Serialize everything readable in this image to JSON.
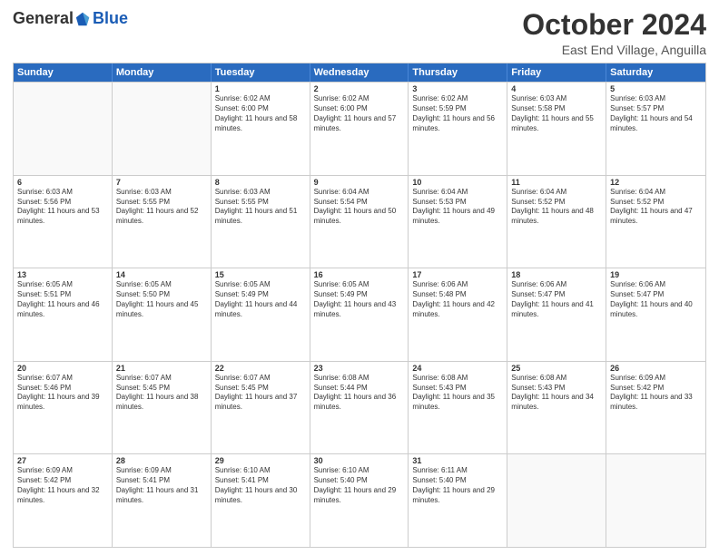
{
  "header": {
    "logo": {
      "general": "General",
      "blue": "Blue"
    },
    "month": "October 2024",
    "location": "East End Village, Anguilla"
  },
  "calendar": {
    "days_of_week": [
      "Sunday",
      "Monday",
      "Tuesday",
      "Wednesday",
      "Thursday",
      "Friday",
      "Saturday"
    ],
    "weeks": [
      [
        {
          "day": "",
          "empty": true
        },
        {
          "day": "",
          "empty": true
        },
        {
          "day": "1",
          "sunrise": "6:02 AM",
          "sunset": "6:00 PM",
          "daylight": "11 hours and 58 minutes."
        },
        {
          "day": "2",
          "sunrise": "6:02 AM",
          "sunset": "6:00 PM",
          "daylight": "11 hours and 57 minutes."
        },
        {
          "day": "3",
          "sunrise": "6:02 AM",
          "sunset": "5:59 PM",
          "daylight": "11 hours and 56 minutes."
        },
        {
          "day": "4",
          "sunrise": "6:03 AM",
          "sunset": "5:58 PM",
          "daylight": "11 hours and 55 minutes."
        },
        {
          "day": "5",
          "sunrise": "6:03 AM",
          "sunset": "5:57 PM",
          "daylight": "11 hours and 54 minutes."
        }
      ],
      [
        {
          "day": "6",
          "sunrise": "6:03 AM",
          "sunset": "5:56 PM",
          "daylight": "11 hours and 53 minutes."
        },
        {
          "day": "7",
          "sunrise": "6:03 AM",
          "sunset": "5:55 PM",
          "daylight": "11 hours and 52 minutes."
        },
        {
          "day": "8",
          "sunrise": "6:03 AM",
          "sunset": "5:55 PM",
          "daylight": "11 hours and 51 minutes."
        },
        {
          "day": "9",
          "sunrise": "6:04 AM",
          "sunset": "5:54 PM",
          "daylight": "11 hours and 50 minutes."
        },
        {
          "day": "10",
          "sunrise": "6:04 AM",
          "sunset": "5:53 PM",
          "daylight": "11 hours and 49 minutes."
        },
        {
          "day": "11",
          "sunrise": "6:04 AM",
          "sunset": "5:52 PM",
          "daylight": "11 hours and 48 minutes."
        },
        {
          "day": "12",
          "sunrise": "6:04 AM",
          "sunset": "5:52 PM",
          "daylight": "11 hours and 47 minutes."
        }
      ],
      [
        {
          "day": "13",
          "sunrise": "6:05 AM",
          "sunset": "5:51 PM",
          "daylight": "11 hours and 46 minutes."
        },
        {
          "day": "14",
          "sunrise": "6:05 AM",
          "sunset": "5:50 PM",
          "daylight": "11 hours and 45 minutes."
        },
        {
          "day": "15",
          "sunrise": "6:05 AM",
          "sunset": "5:49 PM",
          "daylight": "11 hours and 44 minutes."
        },
        {
          "day": "16",
          "sunrise": "6:05 AM",
          "sunset": "5:49 PM",
          "daylight": "11 hours and 43 minutes."
        },
        {
          "day": "17",
          "sunrise": "6:06 AM",
          "sunset": "5:48 PM",
          "daylight": "11 hours and 42 minutes."
        },
        {
          "day": "18",
          "sunrise": "6:06 AM",
          "sunset": "5:47 PM",
          "daylight": "11 hours and 41 minutes."
        },
        {
          "day": "19",
          "sunrise": "6:06 AM",
          "sunset": "5:47 PM",
          "daylight": "11 hours and 40 minutes."
        }
      ],
      [
        {
          "day": "20",
          "sunrise": "6:07 AM",
          "sunset": "5:46 PM",
          "daylight": "11 hours and 39 minutes."
        },
        {
          "day": "21",
          "sunrise": "6:07 AM",
          "sunset": "5:45 PM",
          "daylight": "11 hours and 38 minutes."
        },
        {
          "day": "22",
          "sunrise": "6:07 AM",
          "sunset": "5:45 PM",
          "daylight": "11 hours and 37 minutes."
        },
        {
          "day": "23",
          "sunrise": "6:08 AM",
          "sunset": "5:44 PM",
          "daylight": "11 hours and 36 minutes."
        },
        {
          "day": "24",
          "sunrise": "6:08 AM",
          "sunset": "5:43 PM",
          "daylight": "11 hours and 35 minutes."
        },
        {
          "day": "25",
          "sunrise": "6:08 AM",
          "sunset": "5:43 PM",
          "daylight": "11 hours and 34 minutes."
        },
        {
          "day": "26",
          "sunrise": "6:09 AM",
          "sunset": "5:42 PM",
          "daylight": "11 hours and 33 minutes."
        }
      ],
      [
        {
          "day": "27",
          "sunrise": "6:09 AM",
          "sunset": "5:42 PM",
          "daylight": "11 hours and 32 minutes."
        },
        {
          "day": "28",
          "sunrise": "6:09 AM",
          "sunset": "5:41 PM",
          "daylight": "11 hours and 31 minutes."
        },
        {
          "day": "29",
          "sunrise": "6:10 AM",
          "sunset": "5:41 PM",
          "daylight": "11 hours and 30 minutes."
        },
        {
          "day": "30",
          "sunrise": "6:10 AM",
          "sunset": "5:40 PM",
          "daylight": "11 hours and 29 minutes."
        },
        {
          "day": "31",
          "sunrise": "6:11 AM",
          "sunset": "5:40 PM",
          "daylight": "11 hours and 29 minutes."
        },
        {
          "day": "",
          "empty": true
        },
        {
          "day": "",
          "empty": true
        }
      ]
    ]
  }
}
